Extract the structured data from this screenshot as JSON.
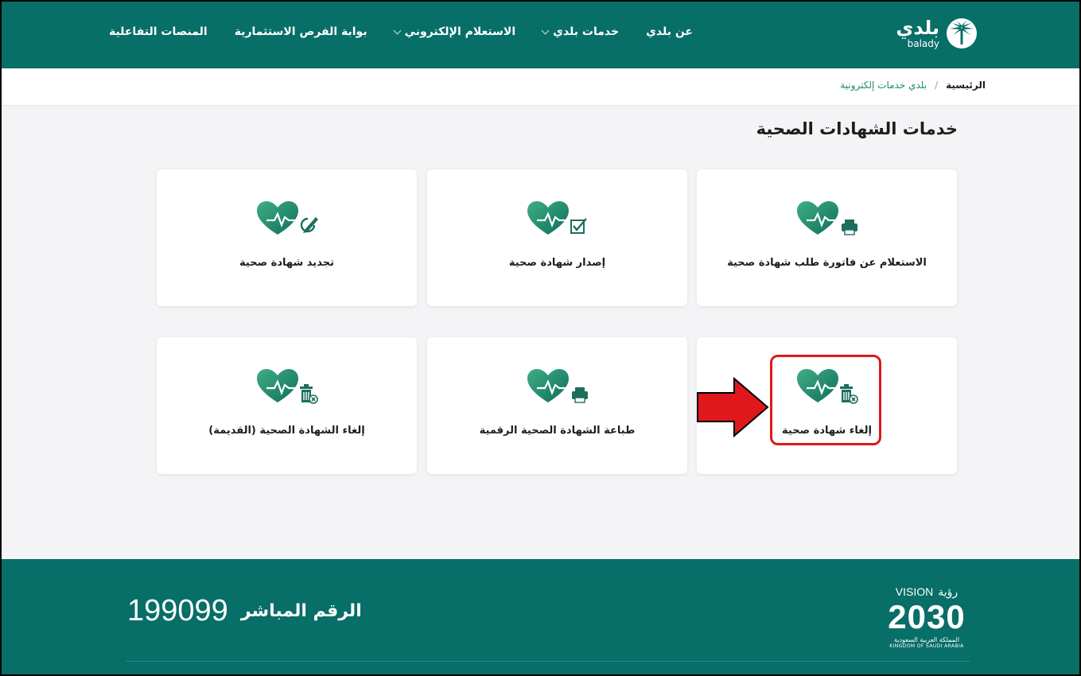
{
  "header": {
    "logo_ar": "بلدي",
    "logo_en": "balady",
    "nav": [
      {
        "label": "عن بلدي",
        "dropdown": false
      },
      {
        "label": "خدمات بلدي",
        "dropdown": true
      },
      {
        "label": "الاستعلام الإلكتروني",
        "dropdown": true
      },
      {
        "label": "بوابة الفرص الاستثمارية",
        "dropdown": false
      },
      {
        "label": "المنصات التفاعلية",
        "dropdown": false
      }
    ]
  },
  "breadcrumb": {
    "home": "الرئيسية",
    "separator": "/",
    "current": "بلدي خدمات إلكترونية"
  },
  "page_title": "خدمات الشهادات الصحية",
  "cards": [
    {
      "label": "الاستعلام عن فاتورة طلب شهادة صحية",
      "icon": "heart-printer-icon"
    },
    {
      "label": "إصدار شهادة صحية",
      "icon": "heart-checkbox-icon"
    },
    {
      "label": "تجديد شهادة صحية",
      "icon": "heart-renew-icon"
    },
    {
      "label": "إلغاء شهادة صحية",
      "icon": "heart-trash-icon",
      "highlighted": true
    },
    {
      "label": "طباعة الشهادة الصحية الرقمية",
      "icon": "heart-printer-icon"
    },
    {
      "label": "إلغاء الشهادة الصحية (القديمة)",
      "icon": "heart-trash-icon"
    }
  ],
  "footer": {
    "hotline_label": "الرقم المباشر",
    "hotline_number": "199099",
    "vision_ar": "رؤية",
    "vision_en": "VISION",
    "vision_year": "2030",
    "vision_kingdom_ar": "المملكة العربية السعودية",
    "vision_kingdom_en": "KINGDOM OF SAUDI ARABIA"
  },
  "colors": {
    "brand": "#076e68",
    "icon_green": "#1d8a6a",
    "highlight_red": "#e0181d"
  }
}
